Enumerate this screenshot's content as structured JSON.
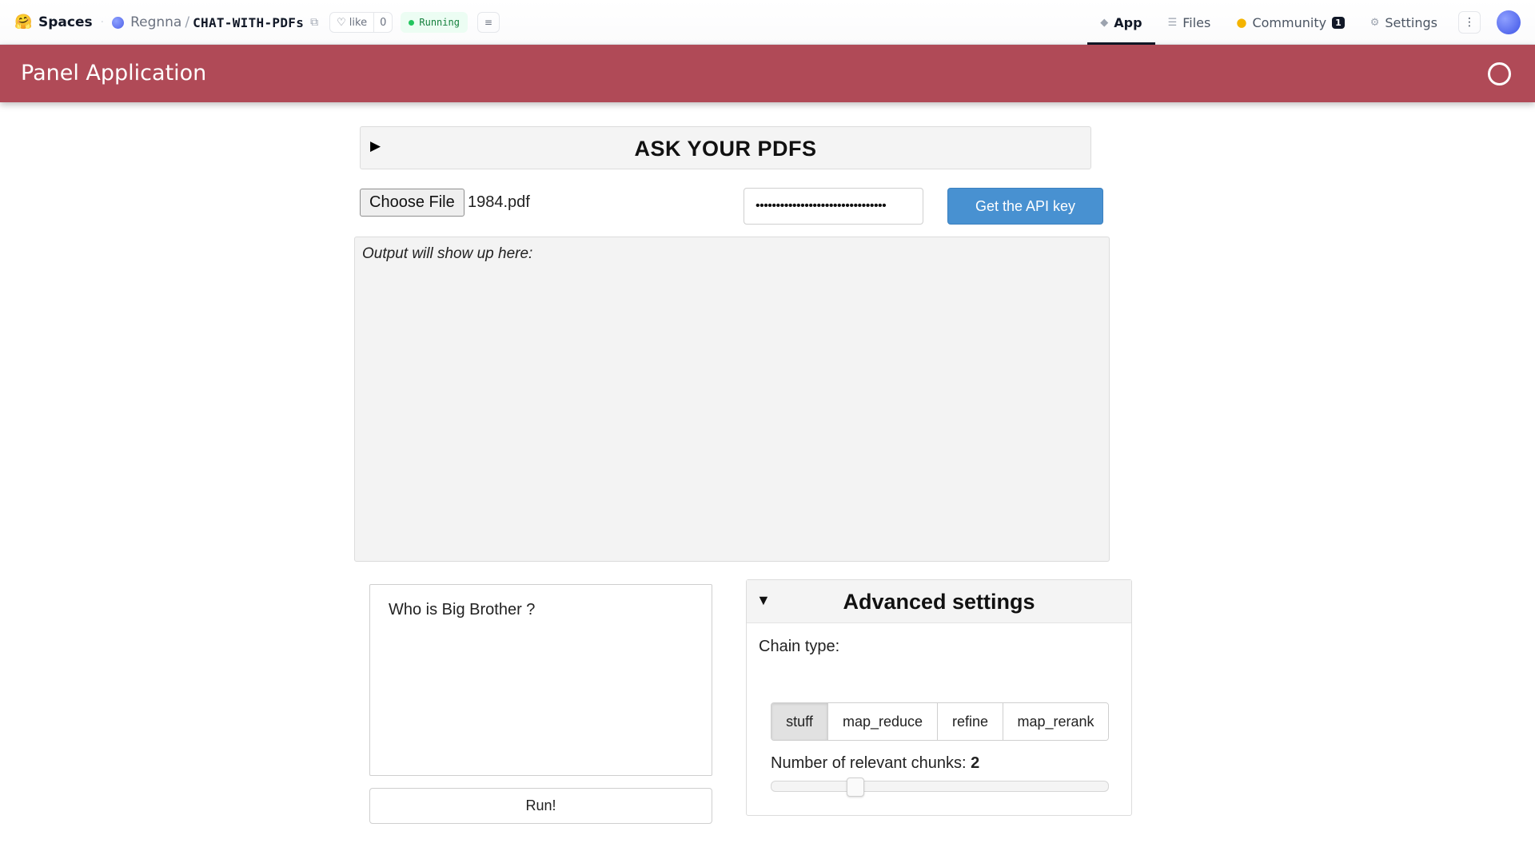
{
  "hf": {
    "spaces_label": "Spaces",
    "owner": "Regnna",
    "repo": "CHAT-WITH-PDFs",
    "like_label": "like",
    "like_count": "0",
    "status": "Running",
    "tabs": [
      {
        "label": "App",
        "icon": "cube-icon",
        "active": true
      },
      {
        "label": "Files",
        "icon": "files-icon",
        "active": false
      },
      {
        "label": "Community",
        "icon": "community-icon",
        "badge": "1",
        "active": false
      },
      {
        "label": "Settings",
        "icon": "gear-icon",
        "active": false
      }
    ]
  },
  "panel": {
    "title": "Panel Application",
    "header_color": "#b04a57"
  },
  "ask": {
    "title": "ASK YOUR PDFS",
    "toggle": "▶"
  },
  "file": {
    "button": "Choose File",
    "name": "1984.pdf"
  },
  "api": {
    "masked_value": "••••••••••••••••••••••••••••••••",
    "button": "Get the API key",
    "button_color": "#4891d1"
  },
  "output": {
    "text": "Output will show up here:"
  },
  "query": {
    "value": "Who is Big Brother ?",
    "run_label": "Run!"
  },
  "advanced": {
    "toggle": "▼",
    "title": "Advanced settings",
    "chain_label": "Chain type:",
    "chain_options": [
      "stuff",
      "map_reduce",
      "refine",
      "map_rerank"
    ],
    "chain_selected": "stuff",
    "chunks_label": "Number of relevant chunks: ",
    "chunks_value": "2",
    "chunks_fraction": 0.25
  }
}
